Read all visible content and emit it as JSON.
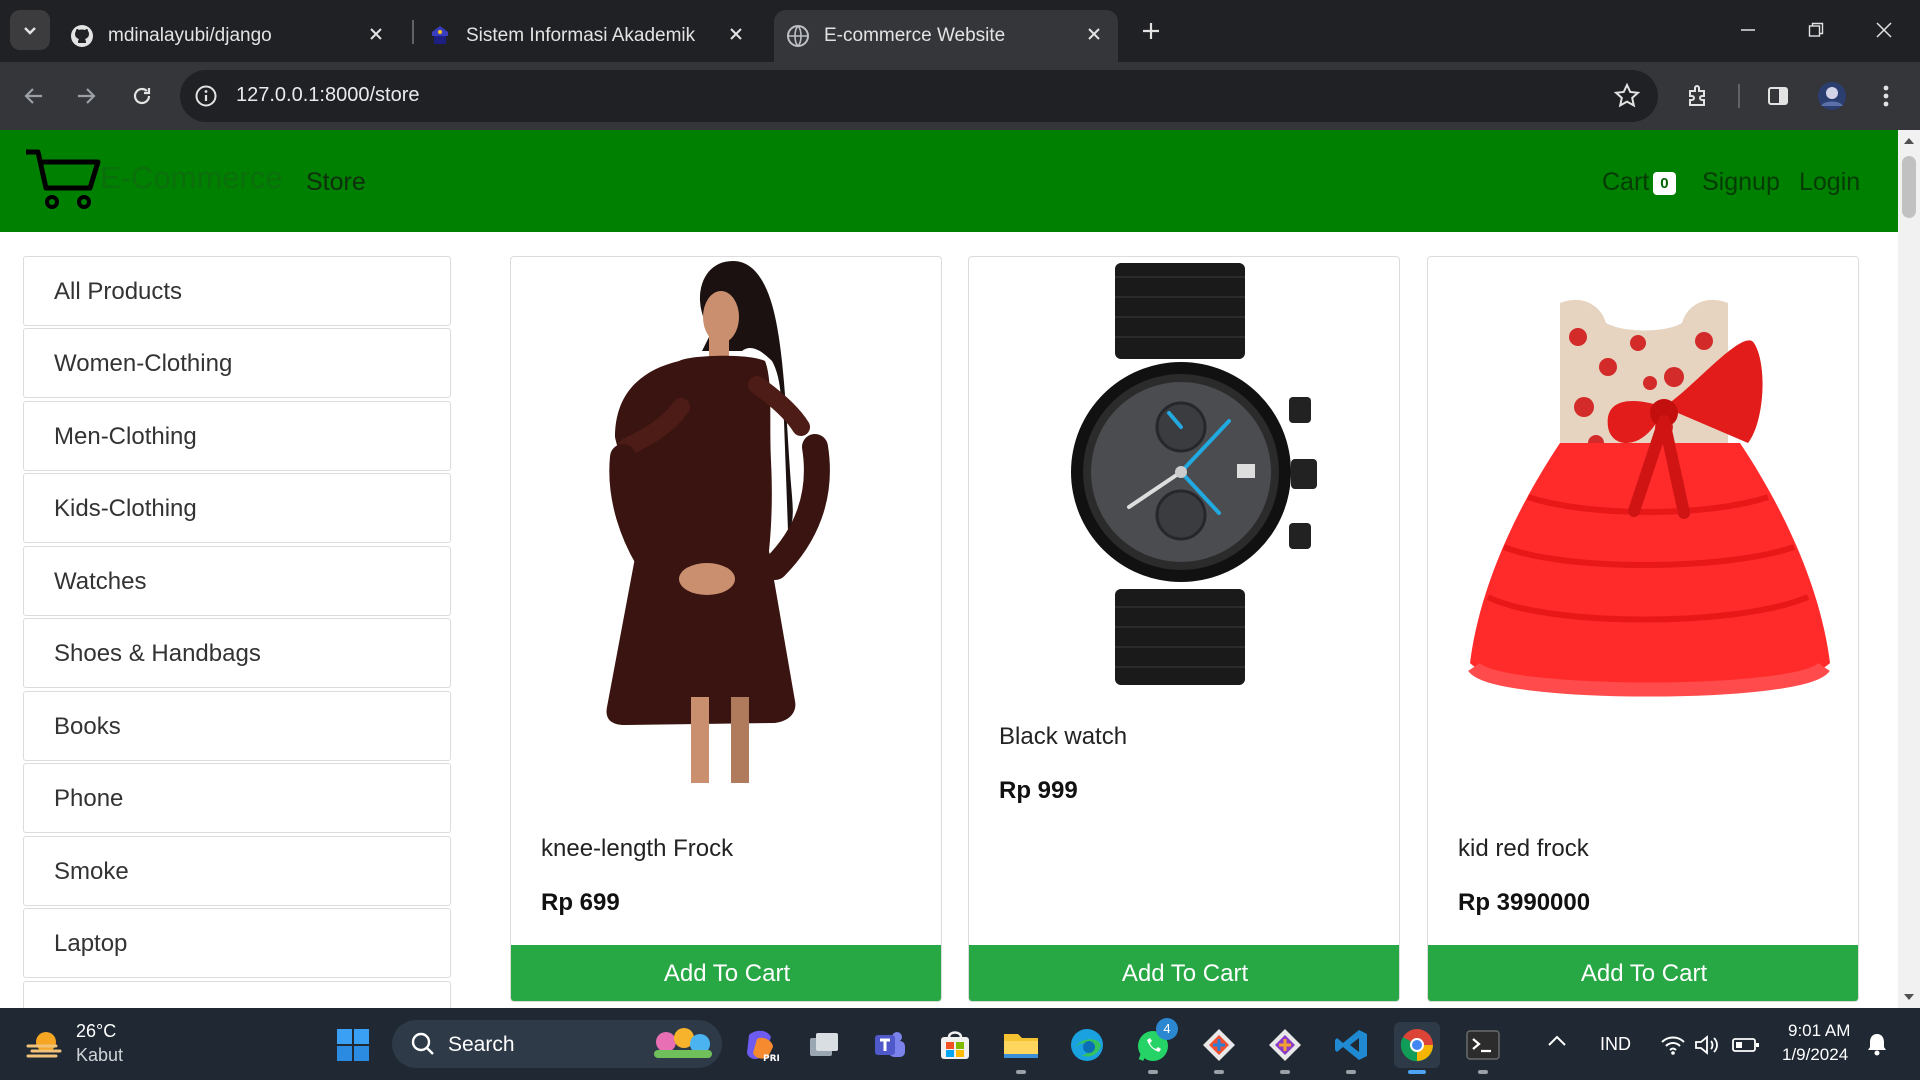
{
  "browser": {
    "tabs": [
      {
        "title": "mdinalayubi/django",
        "icon": "github-icon"
      },
      {
        "title": "Sistem Informasi Akademik",
        "icon": "university-icon"
      },
      {
        "title": "E-commerce Website",
        "icon": "globe-icon",
        "active": true
      }
    ],
    "url": "127.0.0.1:8000/store"
  },
  "site": {
    "brand": "E-Commerce",
    "nav": {
      "store": "Store",
      "cart": "Cart",
      "cart_count": "0",
      "signup": "Signup",
      "login": "Login"
    },
    "colors": {
      "navbar": "#008000",
      "button": "#28a745"
    }
  },
  "categories": [
    "All Products",
    "Women-Clothing",
    "Men-Clothing",
    "Kids-Clothing",
    "Watches",
    "Shoes & Handbags",
    "Books",
    "Phone",
    "Smoke",
    "Laptop"
  ],
  "products": [
    {
      "name": "knee-length Frock",
      "price": "Rp 699",
      "button": "Add To Cart"
    },
    {
      "name": "Black watch",
      "price": "Rp 999",
      "button": "Add To Cart"
    },
    {
      "name": "kid red frock",
      "price": "Rp 3990000",
      "button": "Add To Cart"
    }
  ],
  "taskbar": {
    "weather": {
      "temp": "26°C",
      "desc": "Kabut"
    },
    "search_label": "Search",
    "language": "IND",
    "time": "9:01 AM",
    "date": "1/9/2024",
    "whatsapp_badge": "4"
  }
}
